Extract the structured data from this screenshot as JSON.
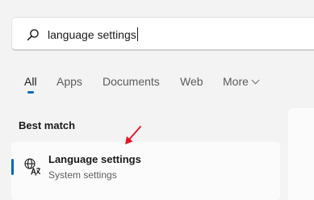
{
  "search": {
    "icon": "search-icon",
    "value": "language settings"
  },
  "tabs": [
    {
      "label": "All",
      "active": true
    },
    {
      "label": "Apps"
    },
    {
      "label": "Documents"
    },
    {
      "label": "Web"
    },
    {
      "label": "More"
    }
  ],
  "best_match": {
    "heading": "Best match",
    "result": {
      "icon": "language-settings-icon",
      "title": "Language settings",
      "subtitle": "System settings"
    }
  },
  "annotation": {
    "icon": "red-arrow-icon",
    "color": "#e81123"
  },
  "colors": {
    "accent": "#0067c0",
    "background": "#f3f3f3",
    "card": "#fbfbfb"
  }
}
